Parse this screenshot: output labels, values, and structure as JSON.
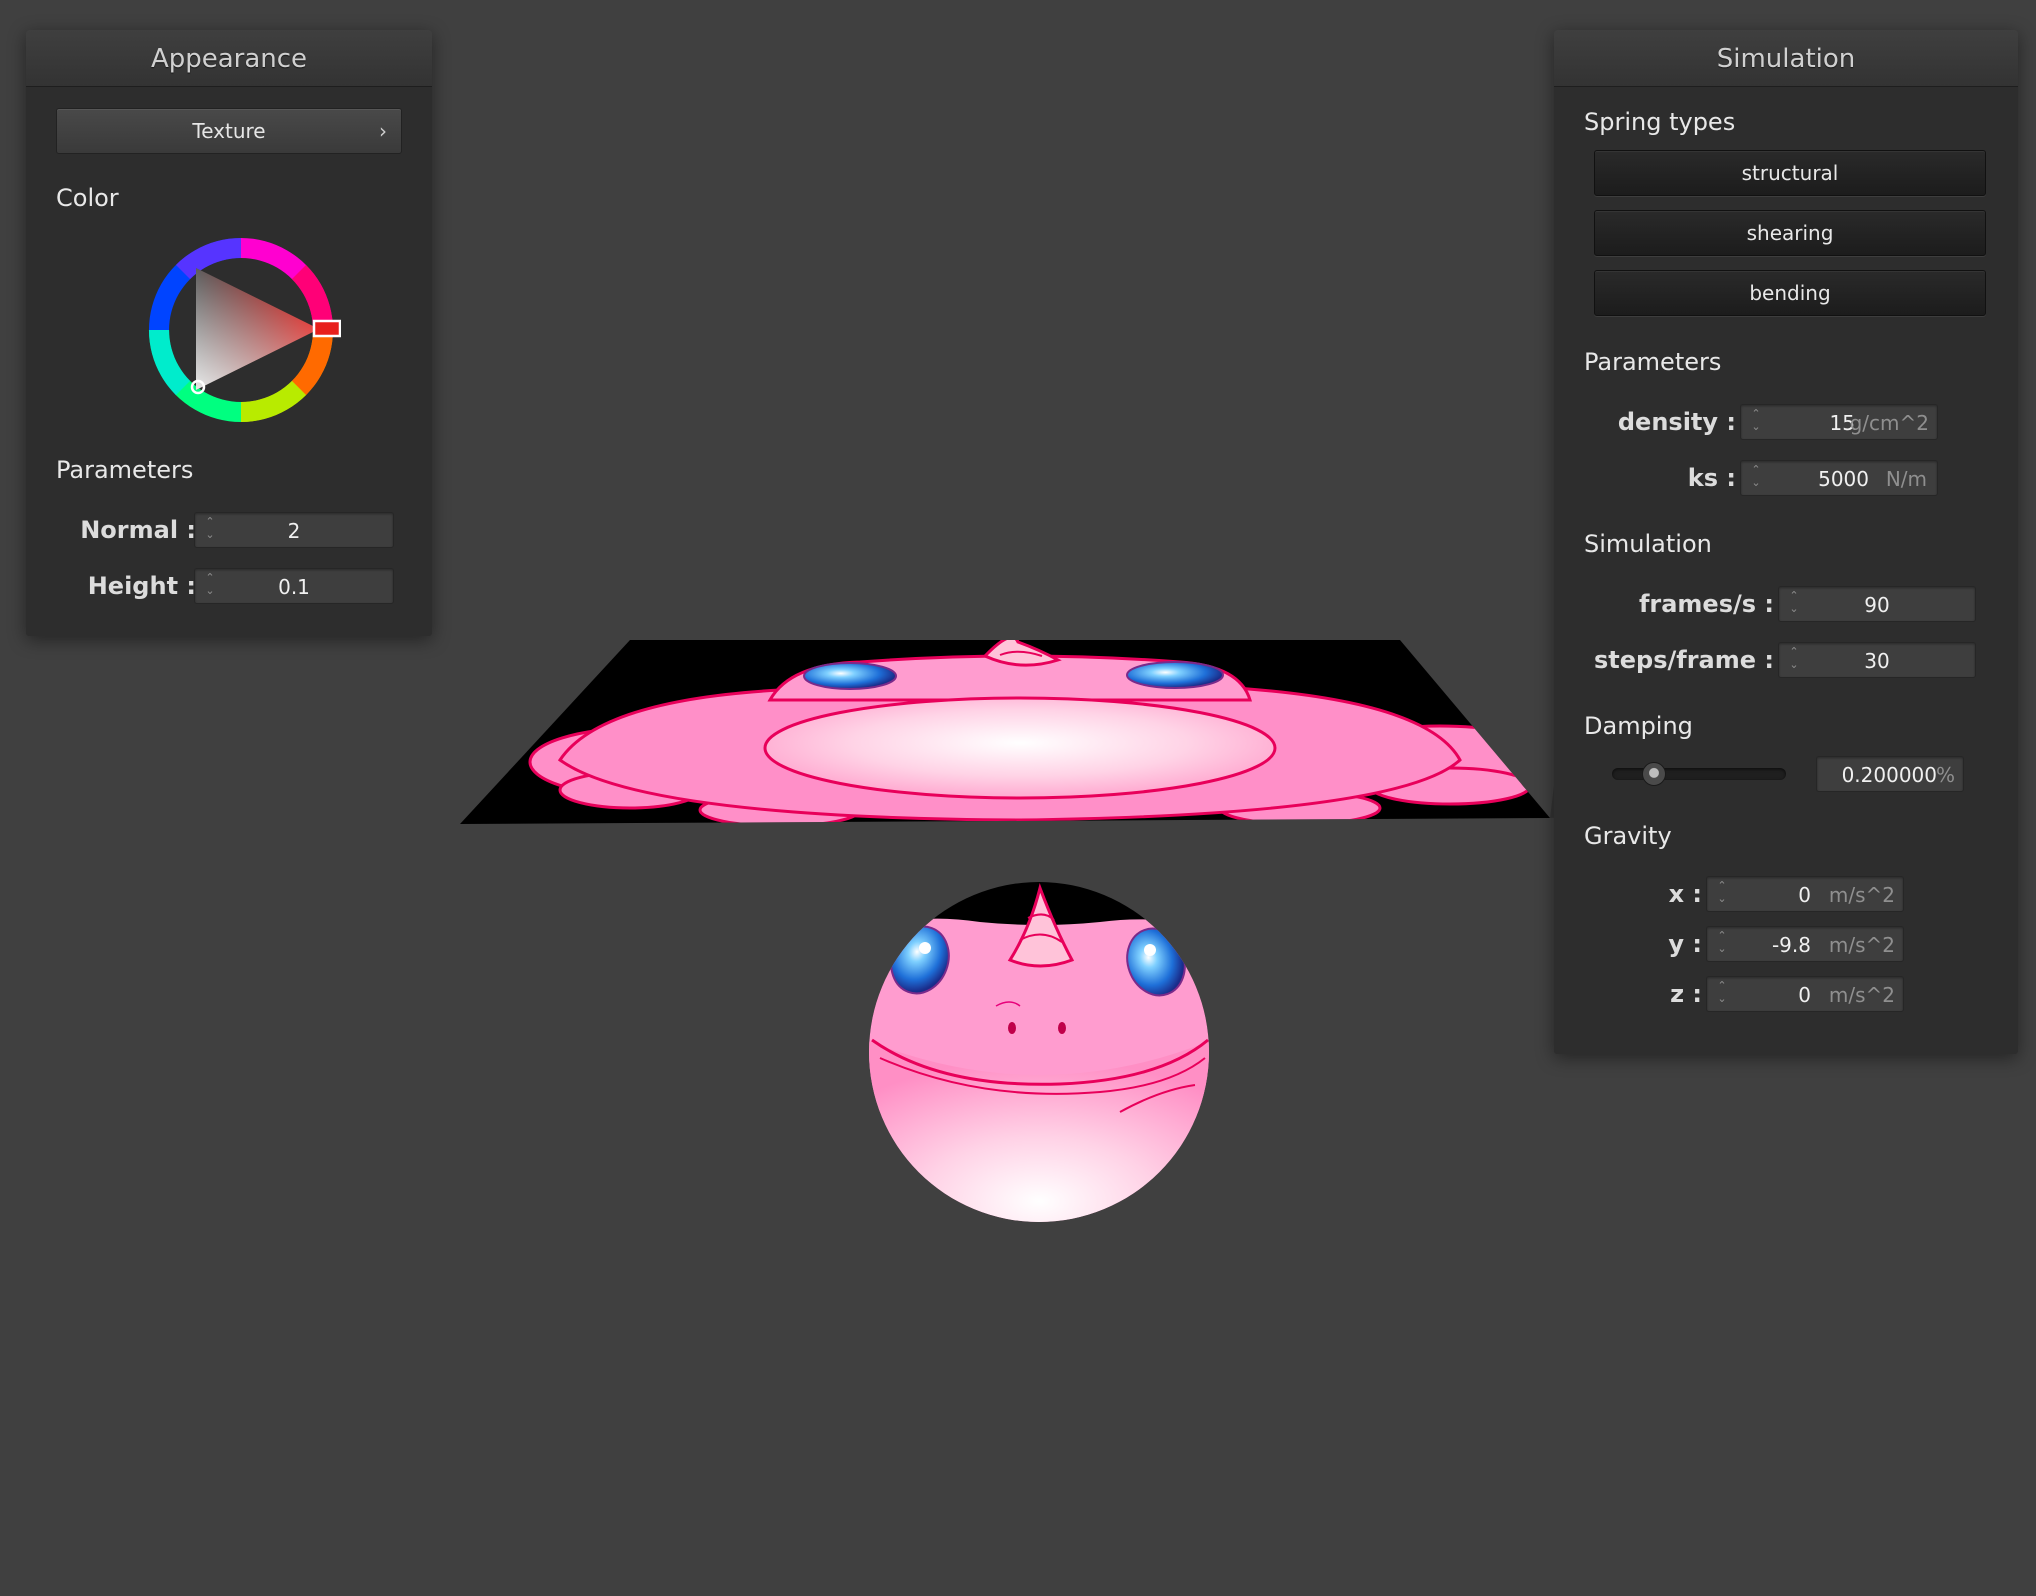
{
  "colors": {
    "background": "#404040",
    "panel": "#2d2d2d",
    "texture_pink": "#ff8fc8",
    "texture_outline": "#e8005a",
    "selected_color": "#e8201c"
  },
  "appearance": {
    "title": "Appearance",
    "texture_button": "Texture",
    "texture_chevron": "›",
    "color_label": "Color",
    "parameters_label": "Parameters",
    "normal": {
      "label": "Normal :",
      "value": "2"
    },
    "height": {
      "label": "Height :",
      "value": "0.1"
    }
  },
  "simulation": {
    "title": "Simulation",
    "spring_types_label": "Spring types",
    "spring_types": [
      "structural",
      "shearing",
      "bending"
    ],
    "parameters_label": "Parameters",
    "density": {
      "label": "density :",
      "value": "15",
      "unit": "g/cm^2"
    },
    "ks": {
      "label": "ks :",
      "value": "5000",
      "unit": "N/m"
    },
    "simulation_label": "Simulation",
    "frames_per_s": {
      "label": "frames/s :",
      "value": "90"
    },
    "steps_per_frame": {
      "label": "steps/frame :",
      "value": "30"
    },
    "damping_label": "Damping",
    "damping": {
      "value": "0.200000",
      "unit": "%",
      "slider_fraction": 0.2
    },
    "gravity_label": "Gravity",
    "gravity": [
      {
        "label": "x :",
        "value": "0",
        "unit": "m/s^2"
      },
      {
        "label": "y :",
        "value": "-9.8",
        "unit": "m/s^2"
      },
      {
        "label": "z :",
        "value": "0",
        "unit": "m/s^2"
      }
    ]
  },
  "scene": {
    "objects": [
      "cloth-plane",
      "sphere"
    ]
  }
}
